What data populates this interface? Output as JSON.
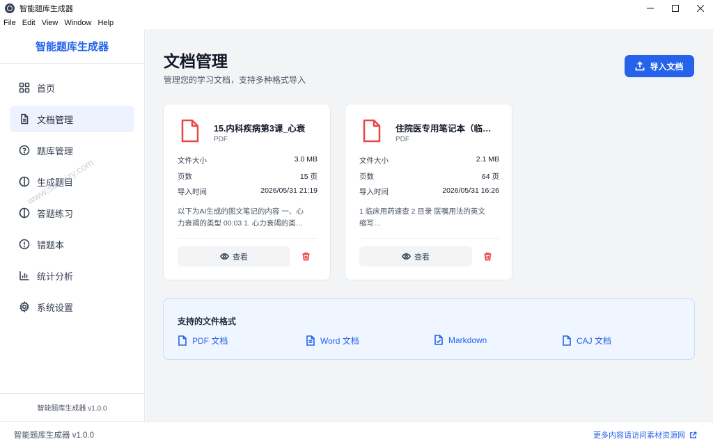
{
  "window": {
    "title": "智能题库生成器",
    "controls": [
      "minimize",
      "maximize",
      "close"
    ]
  },
  "menu": [
    "File",
    "Edit",
    "View",
    "Window",
    "Help"
  ],
  "sidebar": {
    "brand": "智能题库生成器",
    "items": [
      {
        "label": "首页",
        "icon": "grid-icon",
        "active": false
      },
      {
        "label": "文档管理",
        "icon": "document-icon",
        "active": true
      },
      {
        "label": "题库管理",
        "icon": "question-icon",
        "active": false
      },
      {
        "label": "生成题目",
        "icon": "split-circle-icon",
        "active": false
      },
      {
        "label": "答题练习",
        "icon": "split-circle-icon",
        "active": false
      },
      {
        "label": "错题本",
        "icon": "alert-circle-icon",
        "active": false
      },
      {
        "label": "统计分析",
        "icon": "bar-chart-icon",
        "active": false
      },
      {
        "label": "系统设置",
        "icon": "gear-icon",
        "active": false
      }
    ],
    "footer": "智能题库生成器 v1.0.0"
  },
  "main": {
    "title": "文档管理",
    "subtitle": "管理您的学习文档，支持多种格式导入",
    "import_button": "导入文档",
    "labels": {
      "size": "文件大小",
      "pages": "页数",
      "import_time": "导入时间",
      "view": "查看"
    },
    "documents": [
      {
        "name": "15.内科疾病第3课_心衰",
        "type": "PDF",
        "size": "3.0 MB",
        "pages": "15 页",
        "imported": "2026/05/31 21:19",
        "preview_line1": "以下为AI生成的图文笔记的内容 一、心",
        "preview_line2": "力衰竭的类型 00:03 1. 心力衰竭的类…"
      },
      {
        "name": "住院医专用笔记本（临…",
        "type": "PDF",
        "size": "2.1 MB",
        "pages": "64 页",
        "imported": "2026/05/31 16:26",
        "preview_line1": "1 临床用药速查 2 目录 医嘱用法的英文",
        "preview_line2": "缩写…"
      }
    ],
    "formats": {
      "title": "支持的文件格式",
      "items": [
        {
          "label": "PDF 文档",
          "icon": "file-icon"
        },
        {
          "label": "Word 文档",
          "icon": "file-text-icon"
        },
        {
          "label": "Markdown",
          "icon": "file-check-icon"
        },
        {
          "label": "CAJ 文档",
          "icon": "file-icon"
        }
      ]
    }
  },
  "statusbar": {
    "left": "智能题库生成器 v1.0.0",
    "right": "更多内容请访问素材资源网"
  },
  "watermark": "www.sucaizy.com",
  "colors": {
    "accent": "#2563eb",
    "danger": "#ef4444",
    "background": "#f3f4f6",
    "active_nav": "#eef2ff",
    "formats_bg": "#eff6ff"
  }
}
